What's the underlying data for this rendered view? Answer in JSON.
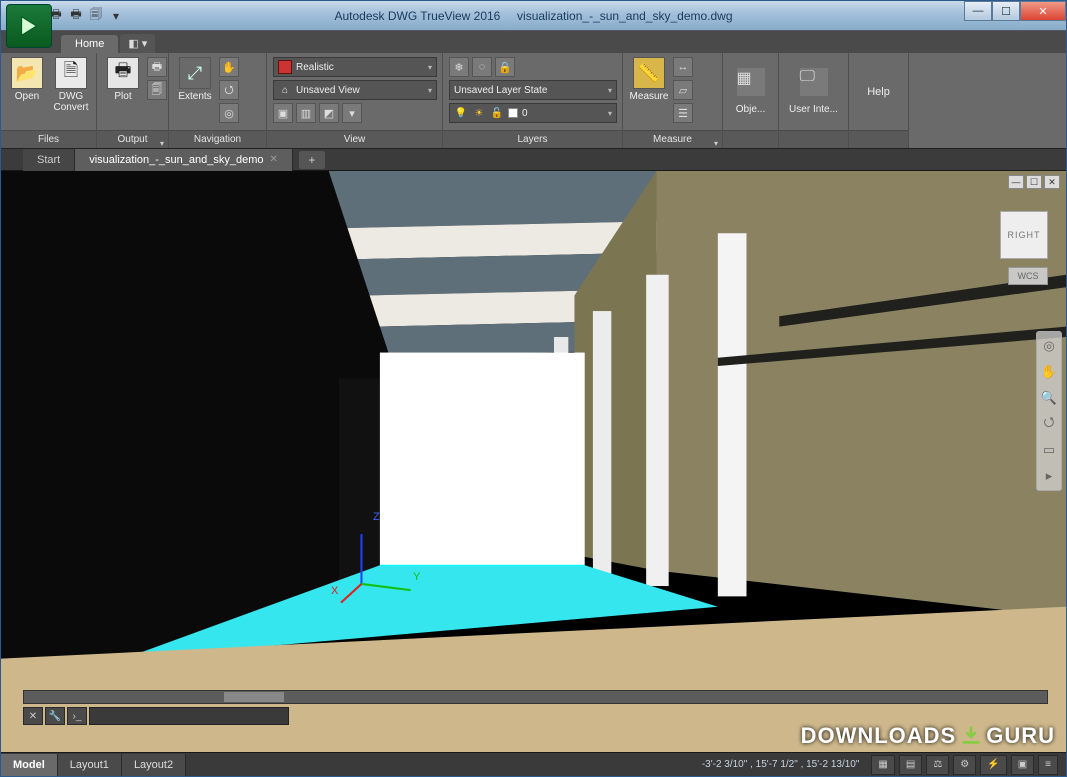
{
  "titlebar": {
    "app_name": "Autodesk DWG TrueView 2016",
    "file_name": "visualization_-_sun_and_sky_demo.dwg"
  },
  "ribbon_tabs": {
    "home": "Home"
  },
  "panels": {
    "files": {
      "title": "Files",
      "open": "Open",
      "convert": "DWG\nConvert"
    },
    "output": {
      "title": "Output",
      "plot": "Plot"
    },
    "navigation": {
      "title": "Navigation",
      "extents": "Extents"
    },
    "view": {
      "title": "View",
      "visual_style": "Realistic",
      "named_view": "Unsaved View"
    },
    "layers": {
      "title": "Layers",
      "state": "Unsaved Layer State",
      "current": "0"
    },
    "measure": {
      "title": "Measure",
      "measure": "Measure"
    },
    "objects": {
      "label": "Obje..."
    },
    "userint": {
      "label": "User Inte..."
    },
    "help": {
      "label": "Help"
    }
  },
  "file_tabs": {
    "start": "Start",
    "doc": "visualization_-_sun_and_sky_demo"
  },
  "viewcube": {
    "face": "RIGHT",
    "cs": "WCS"
  },
  "layout_tabs": {
    "model": "Model",
    "l1": "Layout1",
    "l2": "Layout2"
  },
  "status": {
    "coords": "-3'-2 3/10\" , 15'-7 1/2\" , 15'-2 13/10\""
  },
  "axes": {
    "x": "X",
    "y": "Y",
    "z": "Z"
  },
  "watermark": {
    "a": "DOWNLOADS",
    "b": "GURU"
  }
}
